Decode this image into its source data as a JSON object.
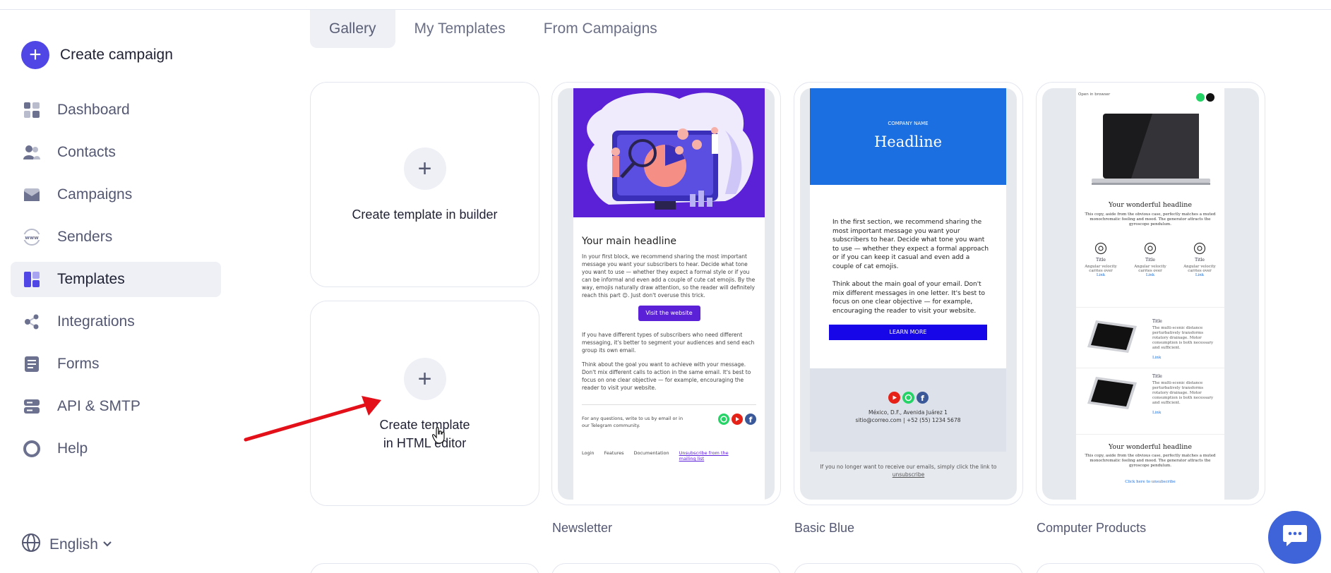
{
  "sidebar": {
    "create_label": "Create campaign",
    "items": [
      {
        "label": "Dashboard",
        "icon": "dashboard-icon",
        "active": false
      },
      {
        "label": "Contacts",
        "icon": "contacts-icon",
        "active": false
      },
      {
        "label": "Campaigns",
        "icon": "campaigns-icon",
        "active": false
      },
      {
        "label": "Senders",
        "icon": "senders-icon",
        "active": false
      },
      {
        "label": "Templates",
        "icon": "templates-icon",
        "active": true
      },
      {
        "label": "Integrations",
        "icon": "integrations-icon",
        "active": false
      },
      {
        "label": "Forms",
        "icon": "forms-icon",
        "active": false
      },
      {
        "label": "API & SMTP",
        "icon": "api-icon",
        "active": false
      },
      {
        "label": "Help",
        "icon": "help-icon",
        "active": false
      }
    ],
    "language": "English"
  },
  "tabs": [
    {
      "label": "Gallery",
      "active": true
    },
    {
      "label": "My Templates",
      "active": false
    },
    {
      "label": "From Campaigns",
      "active": false
    }
  ],
  "create_cards": {
    "builder": {
      "line1": "Create template in builder"
    },
    "html": {
      "line1": "Create template",
      "line2": "in HTML editor"
    }
  },
  "templates": {
    "newsletter": {
      "name": "Newsletter",
      "headline": "Your main headline",
      "p1": "In your first block, we recommend sharing the most important message you want your subscribers to hear. Decide what tone you want to use — whether they expect a formal style or if you can be informal and even add a couple of cute cat emojis. By the way, emojis naturally draw attention, so the reader will definitely reach this part 😊. Just don't overuse this trick.",
      "button": "Visit the website",
      "p2": "If you have different types of subscribers who need different messaging, it's better to segment your audiences and send each group its own email.",
      "p3": "Think about the goal you want to achieve with your message. Don't mix different calls to action in the same email. It's best to focus on one clear objective — for example, encouraging the reader to visit your website.",
      "footer_q": "For any questions, write to us by email or in our Telegram community.",
      "links": [
        "Login",
        "Features",
        "Documentation",
        "Unsubscribe from the mailing list"
      ]
    },
    "basic_blue": {
      "name": "Basic Blue",
      "company": "COMPANY NAME",
      "headline": "Headline",
      "p1": "In the first section, we recommend sharing the most important message you want your subscribers to hear. Decide what tone you want to use — whether they expect a formal approach or if you can keep it casual and even add a couple of cat emojis.",
      "p2": "Think about the main goal of your email. Don't mix different messages in one letter. It's best to focus on one clear objective — for example, encouraging the reader to visit your website.",
      "button": "LEARN MORE",
      "address": "México, D.F., Avenida Juárez 1",
      "contact": "sitio@correo.com | +52 (55) 1234 5678",
      "unsub": "If you no longer want to receive our emails, simply click the link to",
      "unsub_link": "unsubscribe"
    },
    "computer_products": {
      "name": "Computer Products",
      "open_browser": "Open in browser",
      "headline": "Your wonderful headline",
      "desc": "This copy, aside from the obvious case, perfectly matches a muted monochromatic feeling and mood. The generator attracts the gyroscope pendulum.",
      "feature_title": "Title",
      "feature_desc": "Angular velocity carries over",
      "link": "Link",
      "item_desc": "The multi-scenic distance perturbatively transforms rotatory drainage. Motor consumption is both necessary and sufficient.",
      "headline2": "Your wonderful headline",
      "footer": "Click here to unsubscribe"
    }
  },
  "colors": {
    "accent": "#4f46e5",
    "nav_active_bg": "#eef0f6",
    "newsletter_purple": "#5b21d6",
    "basic_blue": "#1c6fe0",
    "chat": "#3f63d8",
    "annotation_arrow": "#e3101a"
  }
}
